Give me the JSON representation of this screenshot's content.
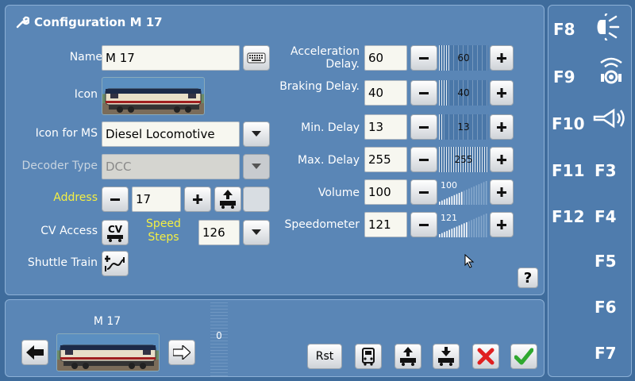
{
  "config": {
    "title": "Configuration M 17",
    "name_label": "Name",
    "name_value": "M 17",
    "icon_label": "Icon",
    "icon_ms_label": "Icon for MS",
    "icon_ms_value": "Diesel Locomotive",
    "decoder_label": "Decoder Type",
    "decoder_value": "DCC",
    "address_label": "Address",
    "address_value": "17",
    "cv_label": "CV Access",
    "cv_button": "CV",
    "speed_steps_label_1": "Speed",
    "speed_steps_label_2": "Steps",
    "speed_steps_value": "126",
    "shuttle_label": "Shuttle Train"
  },
  "params": [
    {
      "label": "Acceleration Delay.",
      "label_1": "Acceleration",
      "label_2": "Delay.",
      "value": "60",
      "slider": "60",
      "level": 0.24
    },
    {
      "label": "Braking Delay.",
      "value": "40",
      "slider": "40",
      "level": 0.16
    },
    {
      "label": "Min. Delay",
      "value": "13",
      "slider": "13",
      "level": 0.05
    },
    {
      "label": "Max. Delay",
      "value": "255",
      "slider": "255",
      "level": 1.0
    },
    {
      "label": "Volume",
      "value": "100",
      "slider": "100",
      "level": 0.5
    },
    {
      "label": "Speedometer",
      "value": "121",
      "slider": "121",
      "level": 0.6
    }
  ],
  "bottom": {
    "loco_name": "M 17",
    "speed_value": "0",
    "rst_label": "Rst"
  },
  "functions": {
    "f8": "F8",
    "f9": "F9",
    "f10": "F10",
    "f11": "F11",
    "f12": "F12",
    "f3": "F3",
    "f4": "F4",
    "f5": "F5",
    "f6": "F6",
    "f7": "F7"
  },
  "help_label": "?",
  "colors": {
    "accent_yellow": "#f4ef43",
    "panel": "#5a86b6",
    "background": "#3f6c9c",
    "ok_green": "#2fa82f",
    "cancel_red": "#e02020"
  }
}
